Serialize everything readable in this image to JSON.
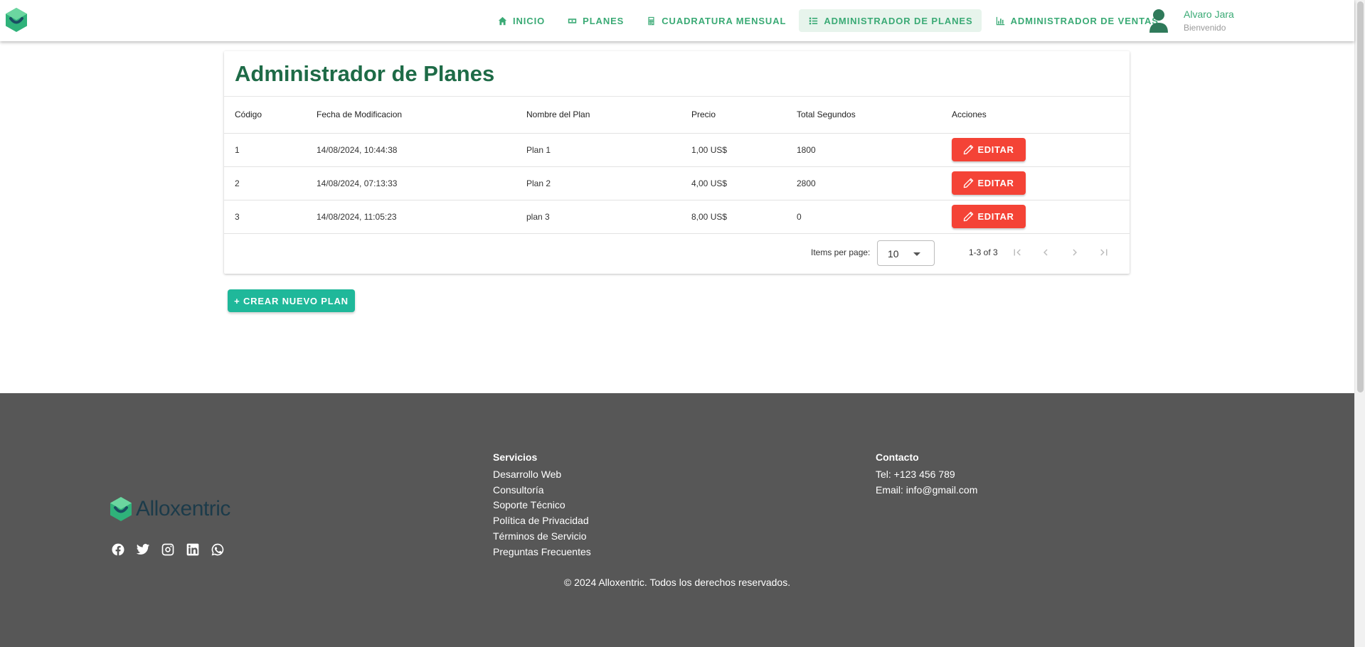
{
  "colors": {
    "primary": "#3aaa75",
    "title": "#1e6b47",
    "danger": "#f44336",
    "teal": "#1fb89a",
    "footer_bg": "#575757"
  },
  "nav": {
    "items": [
      {
        "label": "INICIO",
        "icon": "home-icon"
      },
      {
        "label": "PLANES",
        "icon": "money-icon"
      },
      {
        "label": "CUADRATURA MENSUAL",
        "icon": "calculator-icon"
      },
      {
        "label": "ADMINISTRADOR DE PLANES",
        "icon": "list-icon",
        "active": true
      },
      {
        "label": "ADMINISTRADOR DE VENTAS",
        "icon": "bar-chart-icon"
      }
    ]
  },
  "user": {
    "name": "Alvaro Jara",
    "subtitle": "Bienvenido"
  },
  "page": {
    "title": "Administrador de Planes"
  },
  "table": {
    "headers": [
      "Código",
      "Fecha de Modificacion",
      "Nombre del Plan",
      "Precio",
      "Total Segundos",
      "Acciones"
    ],
    "rows": [
      {
        "codigo": "1",
        "fecha": "14/08/2024, 10:44:38",
        "nombre": "Plan 1",
        "precio": "1,00 US$",
        "segundos": "1800",
        "action": "EDITAR"
      },
      {
        "codigo": "2",
        "fecha": "14/08/2024, 07:13:33",
        "nombre": "Plan 2",
        "precio": "4,00 US$",
        "segundos": "2800",
        "action": "EDITAR"
      },
      {
        "codigo": "3",
        "fecha": "14/08/2024, 11:05:23",
        "nombre": "plan 3",
        "precio": "8,00 US$",
        "segundos": "0",
        "action": "EDITAR"
      }
    ]
  },
  "paginator": {
    "label": "Items per page:",
    "page_size": "10",
    "range": "1-3 of 3"
  },
  "create_button": "+ CREAR NUEVO PLAN",
  "footer": {
    "brand": "Alloxentric",
    "socials": [
      "facebook-icon",
      "twitter-icon",
      "instagram-icon",
      "linkedin-icon",
      "whatsapp-icon"
    ],
    "services": {
      "heading": "Servicios",
      "links": [
        "Desarrollo Web",
        "Consultoría",
        "Soporte Técnico",
        "Política de Privacidad",
        "Términos de Servicio",
        "Preguntas Frecuentes"
      ]
    },
    "contact": {
      "heading": "Contacto",
      "phone": "Tel: +123 456 789",
      "email": "Email: info@gmail.com"
    },
    "copyright": "© 2024 Alloxentric. Todos los derechos reservados."
  }
}
